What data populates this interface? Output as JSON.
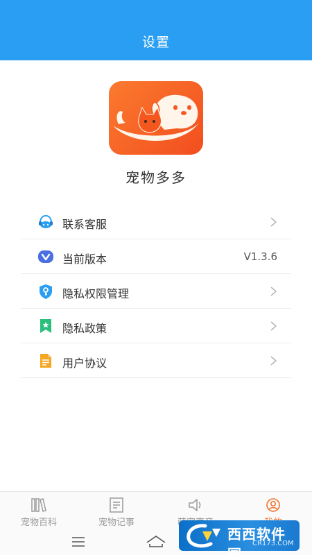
{
  "header": {
    "title": "设置"
  },
  "app": {
    "name": "宠物多多"
  },
  "menu": {
    "items": [
      {
        "label": "联系客服",
        "icon": "customer-service-icon"
      },
      {
        "label": "当前版本",
        "icon": "version-icon",
        "value": "V1.3.6"
      },
      {
        "label": "隐私权限管理",
        "icon": "shield-icon"
      },
      {
        "label": "隐私政策",
        "icon": "bookmark-icon"
      },
      {
        "label": "用户协议",
        "icon": "document-icon"
      }
    ]
  },
  "tabbar": {
    "tabs": [
      {
        "label": "宠物百科",
        "icon": "books-icon"
      },
      {
        "label": "宠物记事",
        "icon": "notes-icon"
      },
      {
        "label": "萌宠声音",
        "icon": "speaker-icon"
      },
      {
        "label": "我的",
        "icon": "profile-icon",
        "active": true
      }
    ]
  },
  "watermark": {
    "text": "西西软件园",
    "sub": "CR173.COM"
  },
  "colors": {
    "header": "#2a9ef2",
    "accent": "#f3722c",
    "app_icon": "#f5581f"
  }
}
